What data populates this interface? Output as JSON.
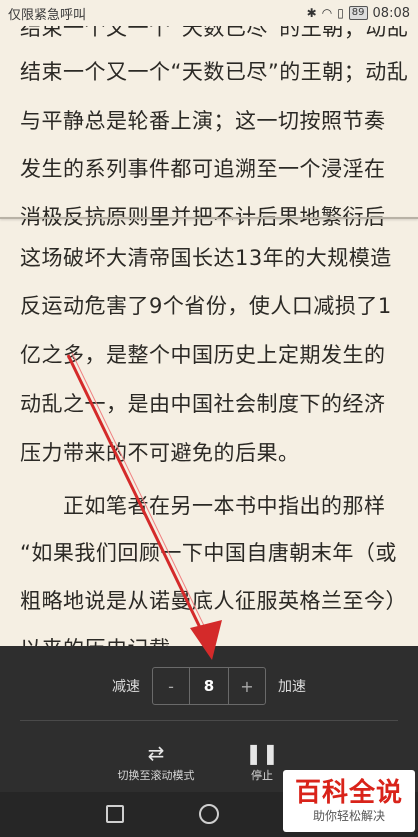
{
  "status_bar": {
    "carrier_text": "仅限紧急呼叫",
    "battery": "89",
    "time": "08:08"
  },
  "reader": {
    "lines": [
      "结束一个又一个“天数已尽”的王朝；动乱",
      "与平静总是轮番上演；这一切按照节奏",
      "发生的系列事件都可追溯至一个浸淫在",
      "消极反抗原则里并把不计后果地繁衍后",
      "这场破坏大清帝国长达13年的大规模造",
      "反运动危害了9个省份，使人口减损了1",
      "亿之多，是整个中国历史上定期发生的",
      "动乱之一，是由中国社会制度下的经济",
      "压力带来的不可避免的后果。",
      "　　正如笔者在另一本书中指出的那样",
      "“如果我们回顾一下中国自唐朝末年（或",
      "粗略地说是从诺曼底人征服英格兰至今）",
      "以来的历史记载，……"
    ]
  },
  "controls": {
    "decrease_label": "减速",
    "increase_label": "加速",
    "minus": "-",
    "plus": "+",
    "speed_value": "8",
    "switch_mode_label": "切换至滚动模式",
    "stop_label": "停止"
  },
  "watermark": {
    "title": "百科全说",
    "subtitle": "助你轻松解决"
  },
  "colors": {
    "page_bg": "#f5efe3",
    "panel_bg": "#2e2e2e",
    "arrow": "#d42a2a"
  }
}
